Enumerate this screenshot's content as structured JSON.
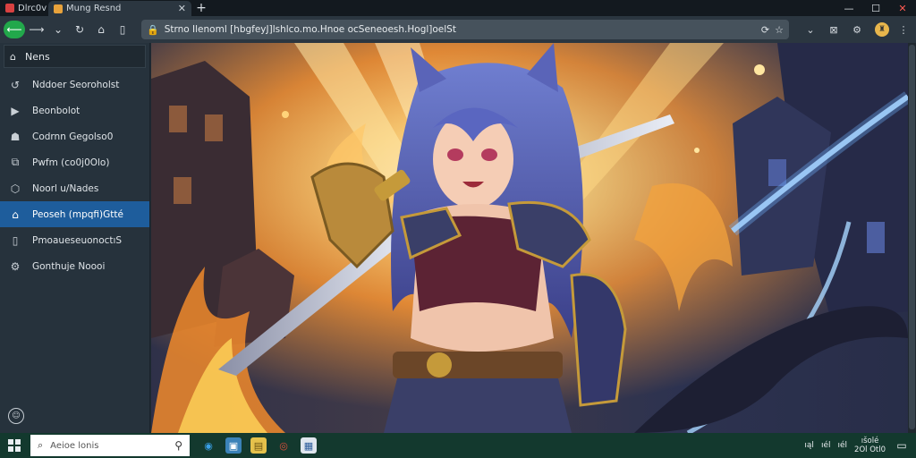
{
  "tabs": [
    {
      "label": "Dlrc0v",
      "active": false,
      "favicon_color": "#d94141"
    },
    {
      "label": "Mung Resnd",
      "active": true,
      "favicon_color": "#e8a23b"
    }
  ],
  "new_tab": "+",
  "window_controls": {
    "minimize": "—",
    "maximize": "☐",
    "close": "✕"
  },
  "toolbar": {
    "url": "Strno Ilenoml [hbgfeyJ]lshlco.mo.Hnoe ocSeneoesh.Hogl]oelSt",
    "nav_icons": [
      "back-green",
      "forward-icon",
      "refresh-icon",
      "home-icon"
    ]
  },
  "sidebar": {
    "top_label": "Nens",
    "items": [
      {
        "icon": "↺",
        "label": "Nddoer Seoroholst",
        "selected": false
      },
      {
        "icon": "▶",
        "label": "Beonbolot",
        "selected": false
      },
      {
        "icon": "☗",
        "label": "Codrnn Gegolso0",
        "selected": false
      },
      {
        "icon": "⧉",
        "label": "Pwfm (co0j0Olo)",
        "selected": false
      },
      {
        "icon": "⬡",
        "label": "Noorl u/Nades",
        "selected": false
      },
      {
        "icon": "⌂",
        "label": "Peoseh (mpqfi)Gtté",
        "selected": true
      },
      {
        "icon": "▯",
        "label": "PmoaueseuonoctıS",
        "selected": false
      },
      {
        "icon": "⚙",
        "label": "Gonthuje Noooi",
        "selected": false
      }
    ]
  },
  "taskbar": {
    "search_placeholder": "Aeioe lonis",
    "clock_time": "ıšolé",
    "clock_date": "2Ol Otl0",
    "tray_labels": [
      "ıąl",
      "ıél",
      "ıél"
    ]
  },
  "colors": {
    "sidebar_bg": "#26323c",
    "selected": "#1e5d9c",
    "taskbar": "#13392e",
    "accent_green": "#22a84b"
  }
}
